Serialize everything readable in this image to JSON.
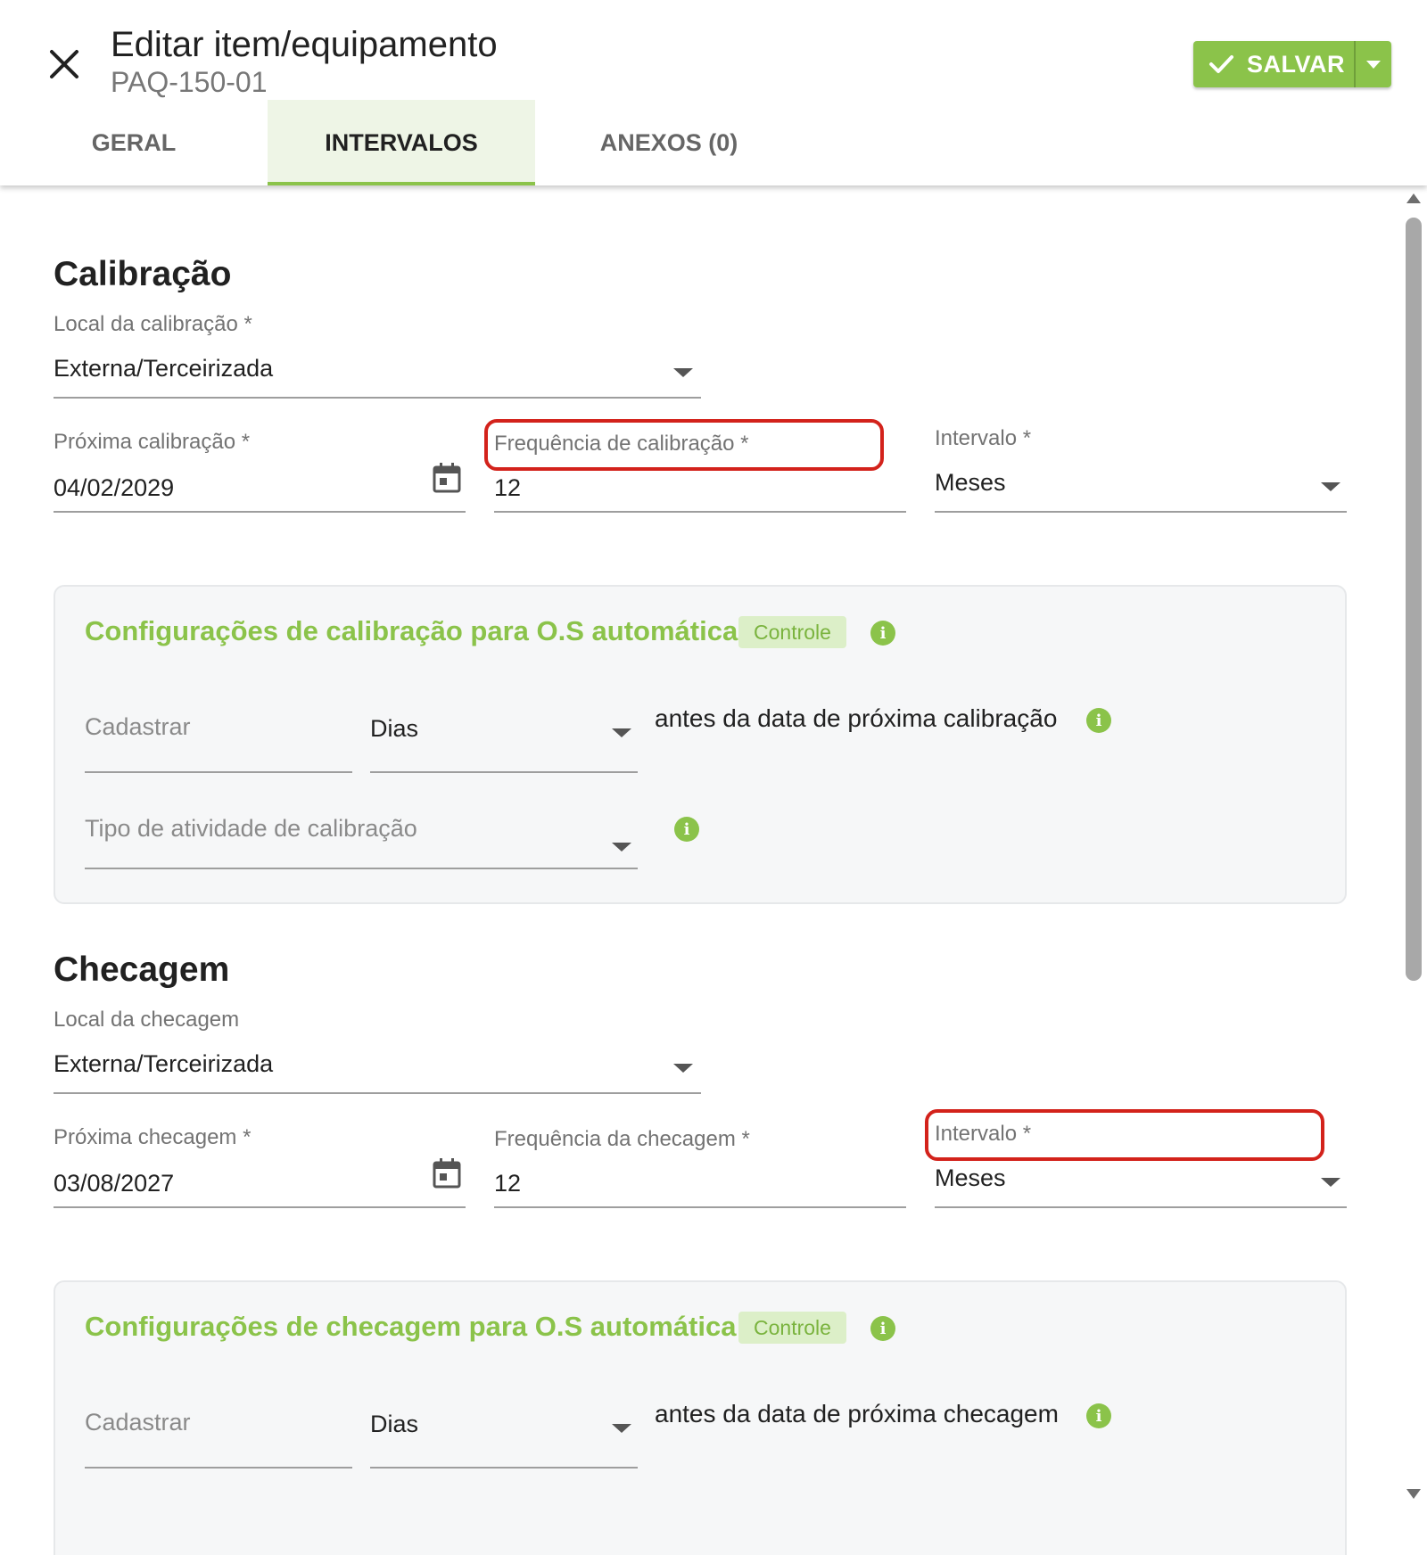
{
  "header": {
    "title": "Editar item/equipamento",
    "subtitle": "PAQ-150-01",
    "save_label": "SALVAR"
  },
  "tabs": [
    {
      "label": "GERAL",
      "active": false
    },
    {
      "label": "INTERVALOS",
      "active": true
    },
    {
      "label": "ANEXOS (0)",
      "active": false
    }
  ],
  "calibracao": {
    "title": "Calibração",
    "local_label": "Local da calibração *",
    "local_value": "Externa/Terceirizada",
    "proxima_label": "Próxima calibração *",
    "proxima_value": "04/02/2029",
    "frequencia_label": "Frequência de calibração *",
    "frequencia_value": "12",
    "intervalo_label": "Intervalo *",
    "intervalo_value": "Meses",
    "config": {
      "title": "Configurações de calibração para O.S automática",
      "chip": "Controle",
      "cadastrar_placeholder": "Cadastrar",
      "unit_value": "Dias",
      "antes_text": "antes da data de próxima calibração",
      "tipo_placeholder": "Tipo de atividade de calibração"
    }
  },
  "checagem": {
    "title": "Checagem",
    "local_label": "Local da checagem",
    "local_value": "Externa/Terceirizada",
    "proxima_label": "Próxima checagem *",
    "proxima_value": "03/08/2027",
    "frequencia_label": "Frequência da checagem *",
    "frequencia_value": "12",
    "intervalo_label": "Intervalo *",
    "intervalo_value": "Meses",
    "config": {
      "title": "Configurações de checagem para O.S automática",
      "chip": "Controle",
      "cadastrar_placeholder": "Cadastrar",
      "unit_value": "Dias",
      "antes_text": "antes da data de próxima checagem"
    }
  },
  "colors": {
    "accent": "#8bc34a",
    "highlight": "#d3221b",
    "card_bg": "#f6f7f8"
  }
}
